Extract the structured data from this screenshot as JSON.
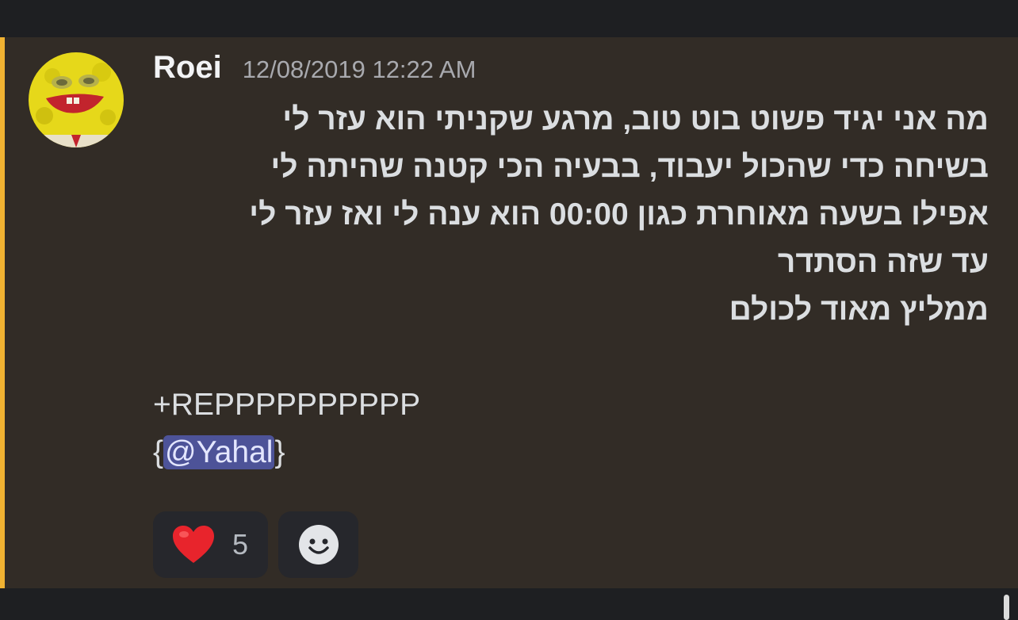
{
  "message": {
    "author": "Roei",
    "timestamp": "12/08/2019 12:22 AM",
    "lines": [
      "מה אני יגיד פשוט בוט טוב, מרגע שקניתי הוא עזר לי",
      "בשיחה כדי שהכול יעבוד, בבעיה הכי קטנה שהיתה לי",
      "אפילו בשעה מאוחרת כגון 00:00 הוא ענה לי ואז עזר לי",
      "עד שזה הסתדר",
      "ממליץ מאוד לכולם"
    ],
    "rep_line": "+REPPPPPPPPPP",
    "mention_open": "{",
    "mention": "@Yahal",
    "mention_close": "}"
  },
  "reactions": [
    {
      "emoji": "red-heart-icon",
      "count": "5"
    },
    {
      "emoji": "add-reaction-icon"
    }
  ],
  "colors": {
    "accent_bar": "#f0b232",
    "mention_bg": "#4d5398",
    "heart": "#e8242c"
  }
}
